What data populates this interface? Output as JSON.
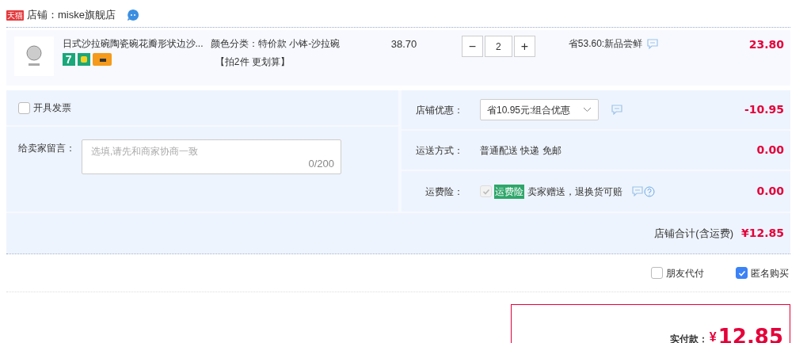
{
  "store": {
    "badge": "天猫",
    "label": "店铺：miske旗舰店"
  },
  "item": {
    "title": "日式沙拉碗陶瓷碗花瓣形状边沙...",
    "tags": [
      {
        "kind": "number",
        "text": "7"
      },
      {
        "kind": "bag"
      },
      {
        "kind": "card"
      }
    ],
    "sku": "颜色分类：特价款 小钵-沙拉碗",
    "promo": "【拍2件 更划算】",
    "unit_price": "38.70",
    "quantity": "2",
    "minus": "−",
    "plus": "+",
    "discount": "省53.60:新品尝鲜",
    "subtotal": "23.80"
  },
  "invoice": {
    "label": "开具发票",
    "checked": false
  },
  "message": {
    "label": "给卖家留言：",
    "placeholder": "选填,请先和商家协商一致",
    "counter": "0/200"
  },
  "rows": [
    {
      "kind": "select",
      "label": "店铺优惠：",
      "value": "省10.95元:组合优惠",
      "amount": "-10.95"
    },
    {
      "kind": "text",
      "label": "运送方式：",
      "value": "普通配送 快递 免邮",
      "amount": "0.00"
    },
    {
      "kind": "insurance",
      "label": "运费险：",
      "checked": true,
      "tag": "运费险",
      "value": "卖家赠送，退换货可赔",
      "amount": "0.00"
    }
  ],
  "store_total": {
    "label": "店铺合计(含运费)",
    "amount": "¥12.85"
  },
  "options": [
    {
      "label": "朋友代付",
      "checked": false
    },
    {
      "label": "匿名购买",
      "checked": true
    }
  ],
  "payment": {
    "label": "实付款：",
    "currency": "¥",
    "amount": "12.85"
  }
}
